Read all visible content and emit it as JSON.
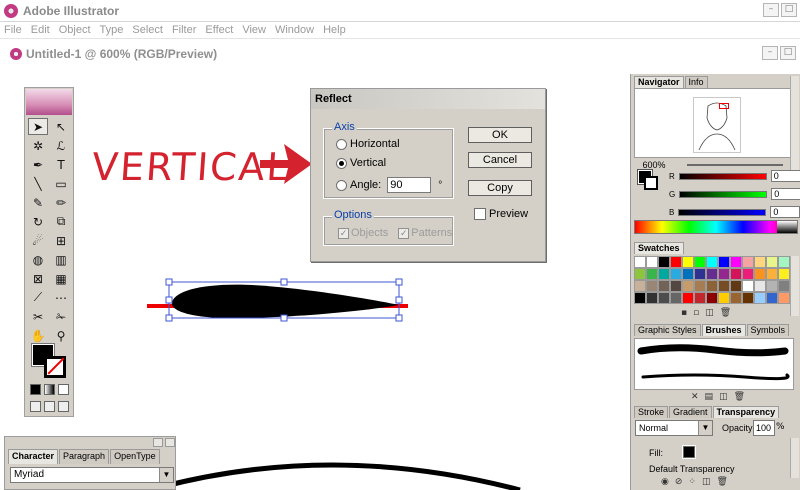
{
  "app": {
    "title": "Adobe Illustrator"
  },
  "menu": [
    "File",
    "Edit",
    "Object",
    "Type",
    "Select",
    "Filter",
    "Effect",
    "View",
    "Window",
    "Help"
  ],
  "document": {
    "title": "Untitled-1 @ 600% (RGB/Preview)"
  },
  "annotation": {
    "text": "VERTICAL"
  },
  "dialog": {
    "title": "Reflect",
    "axis_label": "Axis",
    "horizontal": "Horizontal",
    "vertical": "Vertical",
    "angle_label": "Angle:",
    "angle_value": "90",
    "degree_symbol": "°",
    "options_label": "Options",
    "objects": "Objects",
    "patterns": "Patterns",
    "ok": "OK",
    "cancel": "Cancel",
    "copy": "Copy",
    "preview": "Preview"
  },
  "char_panel": {
    "tabs": [
      "Character",
      "Paragraph",
      "OpenType"
    ],
    "font": "Myriad"
  },
  "navigator": {
    "tabs": [
      "Navigator",
      "Info"
    ],
    "zoom": "600%"
  },
  "color": {
    "r_label": "R",
    "g_label": "G",
    "b_label": "B",
    "r": "0",
    "g": "0",
    "b": "0"
  },
  "swatches": {
    "tab": "Swatches"
  },
  "brushes": {
    "tabs": [
      "Graphic Styles",
      "Brushes",
      "Symbols"
    ]
  },
  "transparency": {
    "tabs": [
      "Stroke",
      "Gradient",
      "Transparency"
    ],
    "blend_mode": "Normal",
    "opacity_label": "Opacity:",
    "opacity": "100",
    "pct": "%",
    "fill_label": "Fill:",
    "default": "Default Transparency"
  },
  "colors": {
    "accent_red": "#d4232f",
    "group_label_blue": "#0a3fa8",
    "panel_grey": "#d4d0c8"
  }
}
